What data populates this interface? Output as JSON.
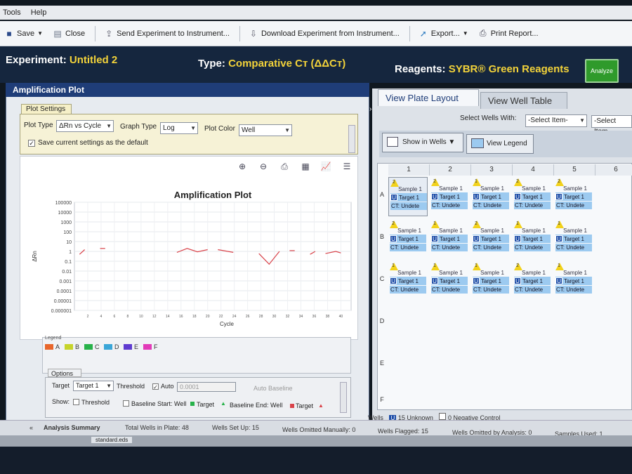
{
  "menubar": {
    "items": [
      "Tools",
      "Help"
    ]
  },
  "toolbar": {
    "save": "Save",
    "close": "Close",
    "send": "Send Experiment to Instrument...",
    "download": "Download Experiment from Instrument...",
    "export": "Export...",
    "print": "Print Report..."
  },
  "experiment": {
    "label": "Experiment:",
    "name": "Untitled 2",
    "type_label": "Type:",
    "type": "Comparative Cт (ΔΔCт)",
    "reagents_label": "Reagents:",
    "reagents": "SYBR® Green Reagents",
    "analyze": "Analyze"
  },
  "amplification": {
    "title": "Amplification Plot",
    "settings_tab": "Plot Settings",
    "plot_type_label": "Plot Type",
    "plot_type": "ΔRn vs Cycle",
    "graph_type_label": "Graph Type",
    "graph_type": "Log",
    "plot_color_label": "Plot Color",
    "plot_color": "Well",
    "save_default": "Save current settings as the default"
  },
  "chart_data": {
    "type": "line",
    "title": "Amplification Plot",
    "xlabel": "Cycle",
    "ylabel": "ΔRn",
    "yscale": "log",
    "ylim": [
      1e-06,
      100000
    ],
    "y_ticks": [
      "100000",
      "10000",
      "1000",
      "100",
      "10",
      "1",
      "0.1",
      "0.01",
      "0.001",
      "0.0001",
      "0.00001",
      "0.000001"
    ],
    "x_ticks": [
      "2",
      "4",
      "6",
      "8",
      "10",
      "12",
      "14",
      "16",
      "18",
      "20",
      "22",
      "24",
      "26",
      "28",
      "30",
      "32",
      "34",
      "36",
      "38",
      "40"
    ],
    "grid": true,
    "series": [
      {
        "color": "#d9434a",
        "points": [
          [
            1,
            0.5
          ],
          [
            2,
            1.5
          ]
        ]
      },
      {
        "color": "#d9434a",
        "points": [
          [
            5,
            2
          ],
          [
            6,
            2
          ]
        ]
      },
      {
        "color": "#d9434a",
        "points": [
          [
            20,
            0.8
          ],
          [
            22,
            2
          ],
          [
            24,
            0.9
          ],
          [
            26,
            1.5
          ]
        ]
      },
      {
        "color": "#d9434a",
        "points": [
          [
            28,
            1.5
          ],
          [
            31,
            0.8
          ]
        ]
      },
      {
        "color": "#d9434a",
        "points": [
          [
            36,
            0.6
          ],
          [
            38,
            0.05
          ],
          [
            40,
            1.0
          ]
        ]
      },
      {
        "color": "#d9434a",
        "points": [
          [
            42,
            1.2
          ],
          [
            43,
            1.2
          ]
        ]
      },
      {
        "color": "#d9434a",
        "points": [
          [
            46,
            0.5
          ],
          [
            47,
            1.0
          ]
        ]
      },
      {
        "color": "#d9434a",
        "points": [
          [
            49,
            0.6
          ],
          [
            51,
            1.0
          ],
          [
            52,
            0.7
          ]
        ]
      }
    ]
  },
  "legend": {
    "label": "Legend",
    "items": [
      {
        "name": "A",
        "color": "#e8662b"
      },
      {
        "name": "B",
        "color": "#c6d42a"
      },
      {
        "name": "C",
        "color": "#27b24a"
      },
      {
        "name": "D",
        "color": "#3aa6d8"
      },
      {
        "name": "E",
        "color": "#5e3bd0"
      },
      {
        "name": "F",
        "color": "#e23ab8"
      }
    ]
  },
  "options": {
    "tab": "Options",
    "target_label": "Target",
    "target": "Target 1",
    "threshold_label": "Threshold",
    "auto_label": "Auto",
    "threshold_value": "0.0001",
    "auto_baseline": "Auto Baseline",
    "show_label": "Show:",
    "threshold": "Threshold",
    "baseline_start": "Baseline Start: Well",
    "target_txt": "Target",
    "baseline_end": "Baseline End: Well",
    "target_txt2": "Target"
  },
  "right": {
    "tab_plate": "View Plate Layout",
    "tab_table": "View Well Table",
    "select_wells": "Select Wells With:",
    "select_item": "-Select Item-",
    "select_item2": "-Select Item",
    "show_in_wells": "Show in Wells",
    "view_legend": "View Legend",
    "columns": [
      "1",
      "2",
      "3",
      "4",
      "5",
      "6"
    ],
    "rows": [
      "A",
      "B",
      "C",
      "D",
      "E",
      "F"
    ],
    "wells_label": "Wells",
    "unknown_count": "15",
    "unknown_label": "Unknown",
    "neg_count": "0",
    "neg_label": "Negative Control"
  },
  "wells": [
    {
      "row": "A",
      "col": 1,
      "flag": "2",
      "sample": "Sample 1",
      "target": "Target 1",
      "ct": "CT: Undete"
    },
    {
      "row": "A",
      "col": 2,
      "flag": "2",
      "sample": "Sample 1",
      "target": "Target 1",
      "ct": "CT: Undete"
    },
    {
      "row": "A",
      "col": 3,
      "flag": "1",
      "sample": "Sample 1",
      "target": "Target 1",
      "ct": "CT: Undete"
    },
    {
      "row": "A",
      "col": 4,
      "flag": "2",
      "sample": "Sample 1",
      "target": "Target 1",
      "ct": "CT: Undete"
    },
    {
      "row": "A",
      "col": 5,
      "flag": "2",
      "sample": "Sample 1",
      "target": "Target 1",
      "ct": "CT: Undete"
    },
    {
      "row": "B",
      "col": 1,
      "flag": "2",
      "sample": "Sample 1",
      "target": "Target 1",
      "ct": "CT: Undete"
    },
    {
      "row": "B",
      "col": 2,
      "flag": "1",
      "sample": "Sample 1",
      "target": "Target 1",
      "ct": "CT: Undete"
    },
    {
      "row": "B",
      "col": 3,
      "flag": "2",
      "sample": "Sample 1",
      "target": "Target 1",
      "ct": "CT: Undete"
    },
    {
      "row": "B",
      "col": 4,
      "flag": "1",
      "sample": "Sample 1",
      "target": "Target 1",
      "ct": "CT: Undete"
    },
    {
      "row": "B",
      "col": 5,
      "flag": "1",
      "sample": "Sample 1",
      "target": "Target 1",
      "ct": "CT: Undete"
    },
    {
      "row": "C",
      "col": 1,
      "flag": "1",
      "sample": "Sample 1",
      "target": "Target 1",
      "ct": "CT: Undete"
    },
    {
      "row": "C",
      "col": 2,
      "flag": "1",
      "sample": "Sample 1",
      "target": "Target 1",
      "ct": "CT: Undete"
    },
    {
      "row": "C",
      "col": 3,
      "flag": "1",
      "sample": "Sample 1",
      "target": "Target 1",
      "ct": "CT: Undete"
    },
    {
      "row": "C",
      "col": 4,
      "flag": "2",
      "sample": "Sample 1",
      "target": "Target 1",
      "ct": "CT: Undete"
    },
    {
      "row": "C",
      "col": 5,
      "flag": "1",
      "sample": "Sample 1",
      "target": "Target 1",
      "ct": "CT: Undete"
    }
  ],
  "status": {
    "analysis_summary": "Analysis Summary",
    "total_wells": "Total Wells in Plate: 48",
    "wells_setup": "Wells Set Up: 15",
    "omitted_manually": "Wells Omitted Manually: 0",
    "flagged": "Wells Flagged: 15",
    "omitted_analysis": "Wells Omitted by Analysis: 0",
    "samples_used": "Samples Used: 1"
  },
  "bottom": {
    "file_tab": "standard.eds"
  }
}
